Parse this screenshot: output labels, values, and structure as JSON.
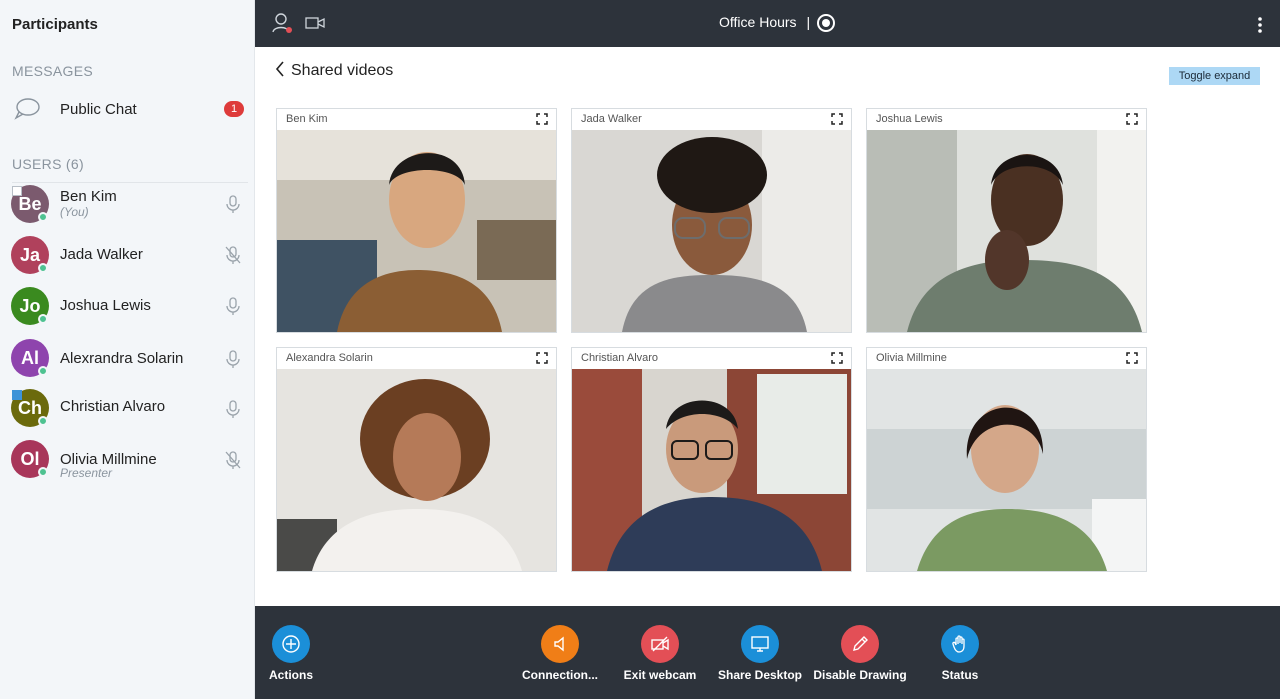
{
  "sidebar": {
    "title": "Participants",
    "messages_header": "MESSAGES",
    "public_chat": {
      "label": "Public Chat",
      "badge": "1"
    },
    "users_header": "USERS (6)",
    "users": [
      {
        "initials": "Be",
        "name": "Ben Kim",
        "sub": "(You)",
        "color": "#7b5a6e",
        "mic": "mic-icon",
        "corner": "white"
      },
      {
        "initials": "Ja",
        "name": "Jada Walker",
        "sub": "",
        "color": "#b0415c",
        "mic": "mic-muted-icon",
        "corner": ""
      },
      {
        "initials": "Jo",
        "name": "Joshua Lewis",
        "sub": "",
        "color": "#3a8a1f",
        "mic": "mic-icon",
        "corner": ""
      },
      {
        "initials": "Al",
        "name": "Alexrandra Solarin",
        "sub": "",
        "color": "#8e44ad",
        "mic": "mic-icon",
        "corner": ""
      },
      {
        "initials": "Ch",
        "name": "Christian Alvaro",
        "sub": "",
        "color": "#6b6a0c",
        "mic": "mic-icon",
        "corner": "blue"
      },
      {
        "initials": "Ol",
        "name": "Olivia Millmine",
        "sub": "Presenter",
        "color": "#a8365a",
        "mic": "mic-muted-icon",
        "corner": ""
      }
    ]
  },
  "topbar": {
    "title": "Office Hours",
    "separator": "|"
  },
  "main": {
    "back_label": "Shared videos",
    "toggle_label": "Toggle expand",
    "videos": [
      {
        "name": "Ben Kim"
      },
      {
        "name": "Jada Walker"
      },
      {
        "name": "Joshua Lewis"
      },
      {
        "name": "Alexandra Solarin"
      },
      {
        "name": "Christian Alvaro"
      },
      {
        "name": "Olivia Millmine"
      }
    ]
  },
  "actions": [
    {
      "label": "Actions",
      "color": "#1b8fd8",
      "icon": "plus-circle-icon"
    },
    {
      "label": "Connection...",
      "color": "#f07e17",
      "icon": "speaker-icon"
    },
    {
      "label": "Exit webcam",
      "color": "#e34f56",
      "icon": "camera-off-icon"
    },
    {
      "label": "Share Desktop",
      "color": "#1b8fd8",
      "icon": "desktop-icon"
    },
    {
      "label": "Disable Drawing",
      "color": "#e34f56",
      "icon": "pencil-icon"
    },
    {
      "label": "Status",
      "color": "#1b8fd8",
      "icon": "hand-icon"
    }
  ],
  "colors": {
    "bar_bg": "#2d333b",
    "sidebar_bg": "#f3f6f9",
    "online_dot": "#4ec291",
    "badge_red": "#de3b3b"
  }
}
